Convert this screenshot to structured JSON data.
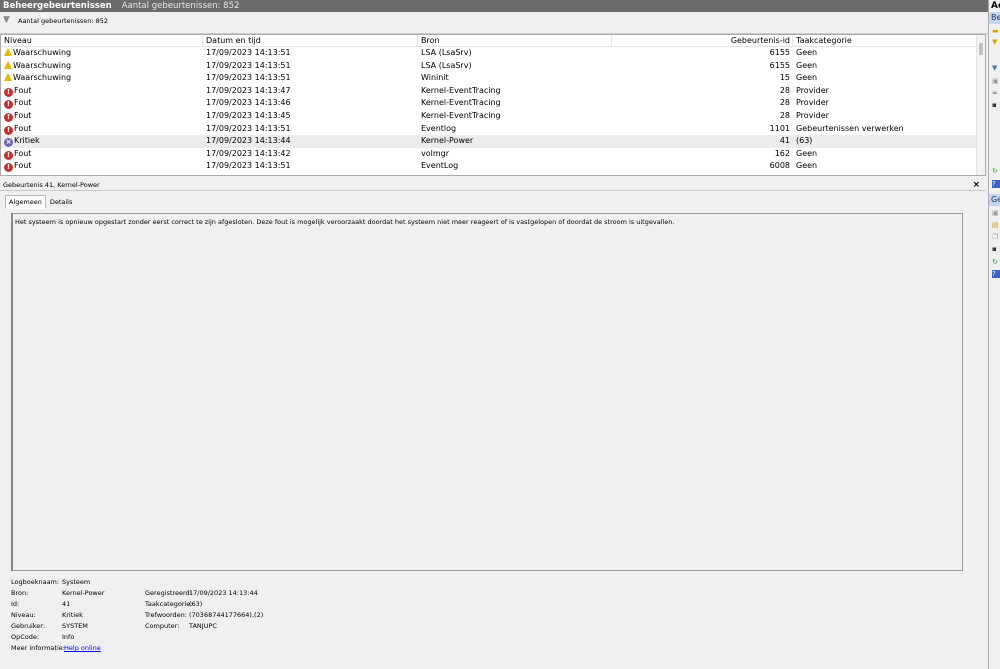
{
  "title": {
    "name": "Beheergebeurtenissen",
    "count": "Aantal gebeurtenissen: 852"
  },
  "filter": {
    "text": "Aantal gebeurtenissen: 852"
  },
  "columns": [
    "Niveau",
    "Datum en tijd",
    "Bron",
    "Gebeurtenis-id",
    "Taakcategorie"
  ],
  "rows": [
    {
      "level": "Waarschuwing",
      "type": "warning",
      "date": "17/09/2023 14:13:51",
      "source": "LSA (LsaSrv)",
      "id": "6155",
      "task": "Geen"
    },
    {
      "level": "Waarschuwing",
      "type": "warning",
      "date": "17/09/2023 14:13:51",
      "source": "LSA (LsaSrv)",
      "id": "6155",
      "task": "Geen"
    },
    {
      "level": "Waarschuwing",
      "type": "warning",
      "date": "17/09/2023 14:13:51",
      "source": "Wininit",
      "id": "15",
      "task": "Geen"
    },
    {
      "level": "Fout",
      "type": "error",
      "date": "17/09/2023 14:13:47",
      "source": "Kernel-EventTracing",
      "id": "28",
      "task": "Provider"
    },
    {
      "level": "Fout",
      "type": "error",
      "date": "17/09/2023 14:13:46",
      "source": "Kernel-EventTracing",
      "id": "28",
      "task": "Provider"
    },
    {
      "level": "Fout",
      "type": "error",
      "date": "17/09/2023 14:13:45",
      "source": "Kernel-EventTracing",
      "id": "28",
      "task": "Provider"
    },
    {
      "level": "Fout",
      "type": "error",
      "date": "17/09/2023 14:13:51",
      "source": "Eventlog",
      "id": "1101",
      "task": "Gebeurtenissen verwerken"
    },
    {
      "level": "Kritiek",
      "type": "critical",
      "date": "17/09/2023 14:13:44",
      "source": "Kernel-Power",
      "id": "41",
      "task": "(63)",
      "selected": true
    },
    {
      "level": "Fout",
      "type": "error",
      "date": "17/09/2023 14:13:42",
      "source": "volmgr",
      "id": "162",
      "task": "Geen"
    },
    {
      "level": "Fout",
      "type": "error",
      "date": "17/09/2023 14:13:51",
      "source": "EventLog",
      "id": "6008",
      "task": "Geen"
    }
  ],
  "detail": {
    "header": "Gebeurtenis 41, Kernel-Power",
    "close": "×",
    "tabs": [
      "Algemeen",
      "Details"
    ],
    "description": "Het systeem is opnieuw opgestart zonder eerst correct te zijn afgesloten. Deze fout is mogelijk veroorzaakt doordat het systeem niet meer reageert of is vastgelopen of doordat de stroom is uitgevallen.",
    "props": {
      "log_label": "Logboeknaam:",
      "log": "Systeem",
      "source_label": "Bron:",
      "source": "Kernel-Power",
      "id_label": "Id:",
      "id": "41",
      "level_label": "Niveau:",
      "level": "Kritiek",
      "user_label": "Gebruiker:",
      "user": "SYSTEM",
      "opcode_label": "OpCode:",
      "opcode": "Info",
      "more_label": "Meer informatie:",
      "more_link": "Help online",
      "logged_label": "Geregistreerd:",
      "logged": "17/09/2023 14:13:44",
      "task_label": "Taakcategorie:",
      "task": "(63)",
      "keywords_label": "Trefwoorden:",
      "keywords": "(70368744177664),(2)",
      "computer_label": "Computer:",
      "computer": "TANJUPC"
    }
  },
  "actions": {
    "header": "Ac",
    "section1": "Be",
    "section2": "Ge"
  }
}
